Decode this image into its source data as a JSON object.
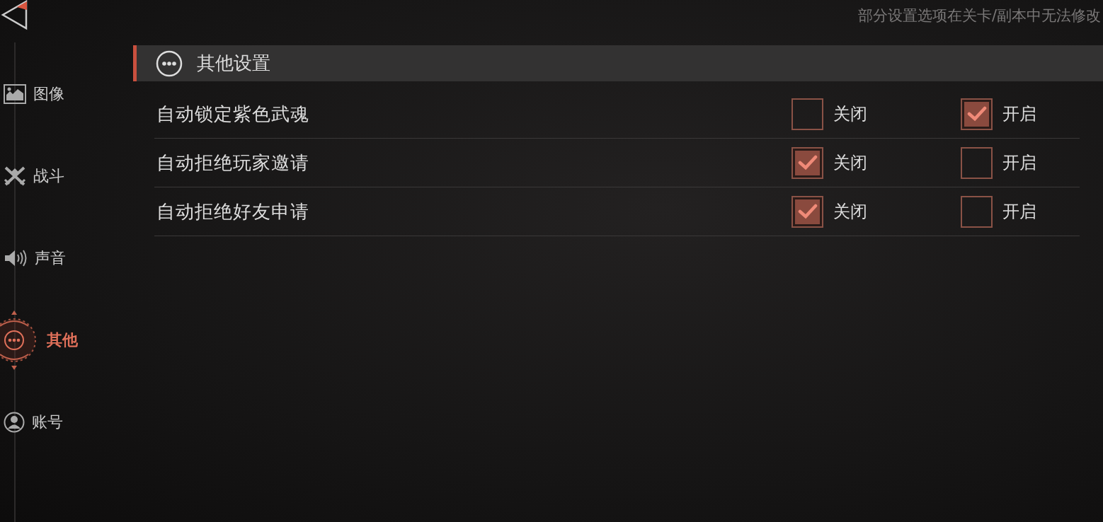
{
  "notice": "部分设置选项在关卡/副本中无法修改",
  "sidebar": {
    "items": [
      {
        "kind": "image",
        "label": "图像",
        "selected": false
      },
      {
        "kind": "combat",
        "label": "战斗",
        "selected": false
      },
      {
        "kind": "sound",
        "label": "声音",
        "selected": false
      },
      {
        "kind": "more",
        "label": "其他",
        "selected": true
      },
      {
        "kind": "account",
        "label": "账号",
        "selected": false
      }
    ]
  },
  "section": {
    "title": "其他设置"
  },
  "rows": [
    {
      "label": "自动锁定紫色武魂",
      "options": [
        {
          "label": "关闭",
          "checked": false
        },
        {
          "label": "开启",
          "checked": true
        }
      ]
    },
    {
      "label": "自动拒绝玩家邀请",
      "options": [
        {
          "label": "关闭",
          "checked": true
        },
        {
          "label": "开启",
          "checked": false
        }
      ]
    },
    {
      "label": "自动拒绝好友申请",
      "options": [
        {
          "label": "关闭",
          "checked": true
        },
        {
          "label": "开启",
          "checked": false
        }
      ]
    }
  ]
}
